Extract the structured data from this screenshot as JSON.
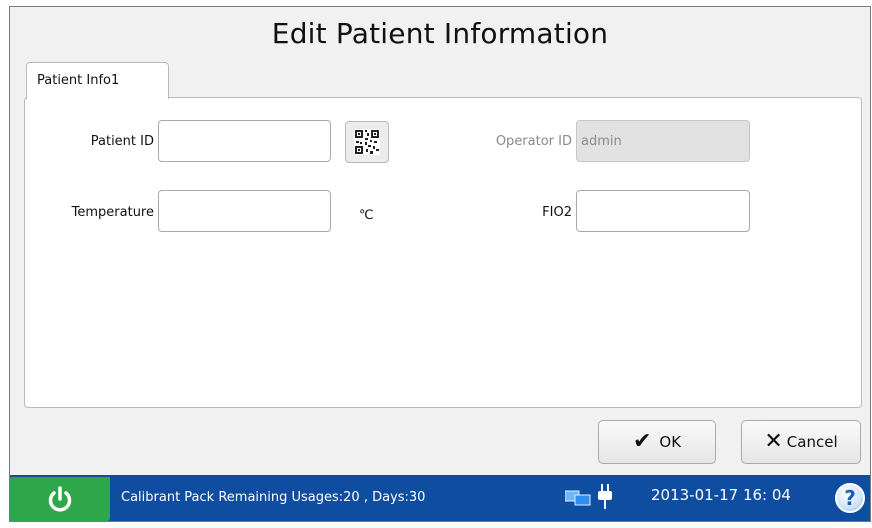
{
  "dialog": {
    "title": "Edit Patient Information",
    "tab_label": "Patient Info1"
  },
  "form": {
    "patient_id": {
      "label": "Patient ID",
      "value": ""
    },
    "operator_id": {
      "label": "Operator ID",
      "value": "admin",
      "disabled": true
    },
    "temperature": {
      "label": "Temperature",
      "value": "",
      "unit": "℃"
    },
    "fio2": {
      "label": "FIO2",
      "value": ""
    }
  },
  "buttons": {
    "ok_label": "OK",
    "cancel_label": "Cancel"
  },
  "statusbar": {
    "message": "Calibrant Pack Remaining Usages:20 , Days:30",
    "datetime": "2013-01-17  16: 04",
    "help_label": "?"
  },
  "icons": {
    "qr": "qr-code-icon",
    "ok": "checkmark-icon",
    "cancel": "x-icon",
    "power": "power-icon",
    "network": "network-icon",
    "plug": "power-plug-icon",
    "help": "help-icon"
  },
  "colors": {
    "statusbar": "#0f4da0",
    "power": "#2ea64a"
  }
}
